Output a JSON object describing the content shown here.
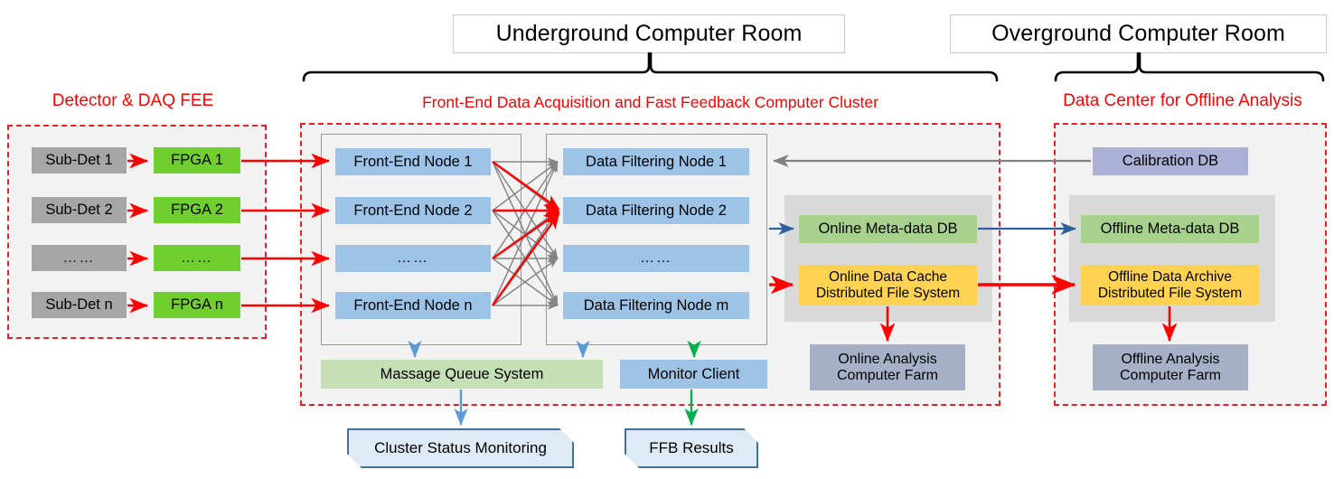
{
  "rooms": {
    "underground": "Underground Computer Room",
    "overground": "Overground Computer Room"
  },
  "sections": {
    "detector": "Detector & DAQ FEE",
    "frontend_cluster": "Front-End Data Acquisition and Fast Feedback Computer Cluster",
    "data_center": "Data Center for Offline Analysis"
  },
  "detector_fee": {
    "sub_detectors": [
      "Sub-Det 1",
      "Sub-Det 2",
      "……",
      "Sub-Det n"
    ],
    "fpgas": [
      "FPGA 1",
      "FPGA 2",
      "……",
      "FPGA n"
    ]
  },
  "front_end_nodes": [
    "Front-End Node 1",
    "Front-End Node 2",
    "……",
    "Front-End Node n"
  ],
  "data_filtering_nodes": [
    "Data Filtering Node 1",
    "Data Filtering Node 2",
    "……",
    "Data Filtering Node m"
  ],
  "online": {
    "meta_db": "Online Meta-data DB",
    "data_cache": "Online Data Cache\nDistributed File System",
    "analysis_farm": "Online Analysis\nComputer Farm"
  },
  "offline": {
    "calibration_db": "Calibration DB",
    "meta_db": "Offline Meta-data DB",
    "data_archive": "Offline Data Archive\nDistributed File System",
    "analysis_farm": "Offline Analysis\nComputer Farm"
  },
  "support": {
    "message_queue": "Massage Queue System",
    "monitor_client": "Monitor Client",
    "cluster_status": "Cluster Status Monitoring",
    "ffb_results": "FFB Results"
  },
  "colors": {
    "red_accent": "#ff0000",
    "dashed_border": "#ee1c25",
    "sub_detector": "#a6a6a6",
    "fpga_green": "#70ce2f",
    "node_blue": "#9dc3e6",
    "meta_db_green": "#a9d18e",
    "cache_yellow": "#ffd351",
    "farm_slate": "#a6b1c8",
    "calibration_purple": "#aab0d6",
    "queue_green": "#c5e0b4",
    "doc_fill": "#deebf7",
    "doc_border": "#41719c",
    "mesh_gray": "#808080",
    "blue_arrow": "#2e5f9e",
    "green_arrow": "#00b050",
    "panel_bg": "#f2f2f2",
    "inner_panel_bg": "#d9d9d9"
  }
}
